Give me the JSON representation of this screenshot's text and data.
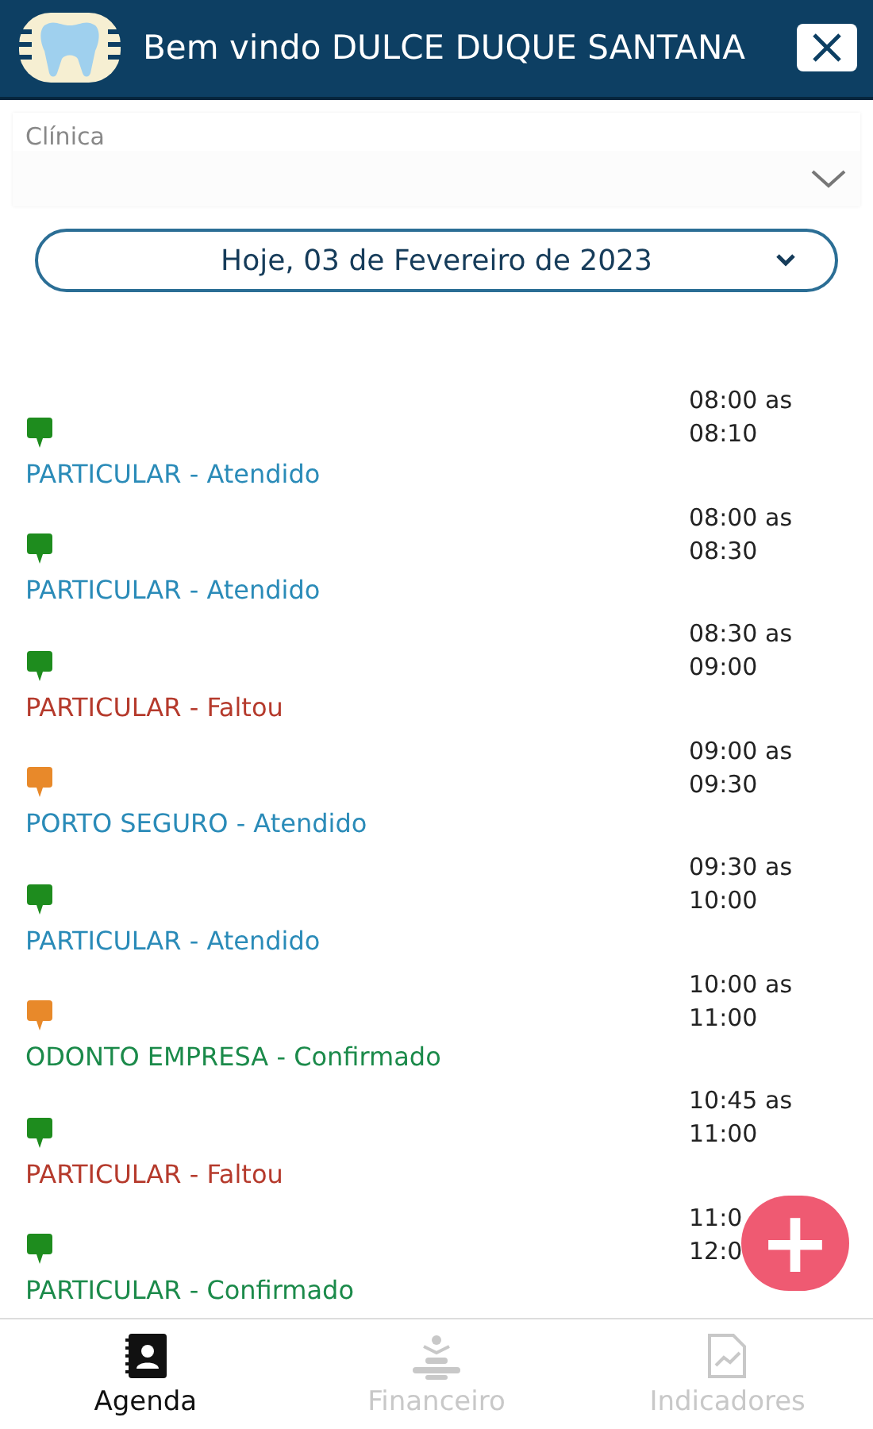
{
  "header": {
    "title": "Bem vindo DULCE DUQUE SANTANA"
  },
  "clinic_select": {
    "label": "Clínica"
  },
  "date_picker": {
    "value": "Hoje, 03 de Fevereiro de 2023"
  },
  "appointments": [
    {
      "color": "#1e8c1e",
      "label": "PARTICULAR - Atendido",
      "kind": "attended",
      "time": "08:00 as",
      "time_end": "08:10"
    },
    {
      "color": "#1e8c1e",
      "label": "PARTICULAR - Atendido",
      "kind": "attended",
      "time": "08:00 as",
      "time_end": "08:30"
    },
    {
      "color": "#1e8c1e",
      "label": "PARTICULAR - Faltou",
      "kind": "missed",
      "time": "08:30 as",
      "time_end": "09:00"
    },
    {
      "color": "#e8892a",
      "label": "PORTO SEGURO - Atendido",
      "kind": "attended",
      "time": "09:00 as",
      "time_end": "09:30"
    },
    {
      "color": "#1e8c1e",
      "label": "PARTICULAR - Atendido",
      "kind": "attended",
      "time": "09:30 as",
      "time_end": "10:00"
    },
    {
      "color": "#e8892a",
      "label": "ODONTO EMPRESA - Confirmado",
      "kind": "confirmed",
      "time": "10:00 as",
      "time_end": "11:00"
    },
    {
      "color": "#1e8c1e",
      "label": "PARTICULAR - Faltou",
      "kind": "missed",
      "time": "10:45 as",
      "time_end": "11:00"
    },
    {
      "color": "#1e8c1e",
      "label": "PARTICULAR - Confirmado",
      "kind": "confirmed",
      "time": "11:0",
      "time_end": "12:0"
    }
  ],
  "add_button": {
    "symbol": "+"
  },
  "tabs": [
    {
      "label": "Agenda",
      "selected": true,
      "kind": "agenda"
    },
    {
      "label": "Financeiro",
      "selected": false,
      "kind": "finance"
    },
    {
      "label": "Indicadores",
      "selected": false,
      "kind": "chart"
    }
  ]
}
